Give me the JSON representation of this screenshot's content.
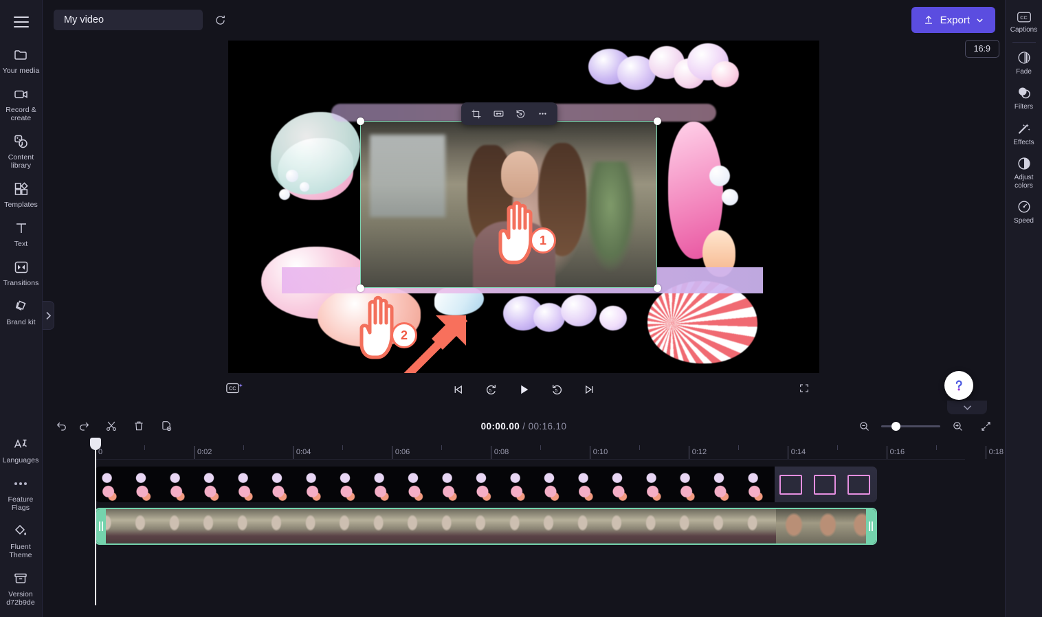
{
  "app": {
    "project_title": "My video",
    "export_label": "Export",
    "aspect_ratio": "16:9"
  },
  "left_rail": {
    "menu_icon": "hamburger-icon",
    "items": [
      {
        "label": "Your media",
        "icon": "folder-icon"
      },
      {
        "label": "Record & create",
        "icon": "video-camera-icon"
      },
      {
        "label": "Content library",
        "icon": "media-library-icon"
      },
      {
        "label": "Templates",
        "icon": "templates-grid-icon"
      },
      {
        "label": "Text",
        "icon": "text-T-icon"
      },
      {
        "label": "Transitions",
        "icon": "transitions-icon"
      },
      {
        "label": "Brand kit",
        "icon": "brand-kit-icon"
      }
    ],
    "bottom_items": [
      {
        "label": "Languages",
        "icon": "languages-icon"
      },
      {
        "label": "Feature Flags",
        "icon": "ellipsis-icon"
      },
      {
        "label": "Fluent Theme",
        "icon": "paint-drop-icon"
      },
      {
        "label": "Version d72b9de",
        "icon": "archive-box-icon"
      }
    ]
  },
  "right_rail": {
    "items": [
      {
        "label": "Captions",
        "icon": "cc-icon"
      },
      {
        "label": "Fade",
        "icon": "fade-circle-icon"
      },
      {
        "label": "Filters",
        "icon": "filters-overlap-icon"
      },
      {
        "label": "Effects",
        "icon": "magic-wand-icon"
      },
      {
        "label": "Adjust colors",
        "icon": "contrast-half-circle-icon"
      },
      {
        "label": "Speed",
        "icon": "speedometer-icon"
      }
    ]
  },
  "stage": {
    "chip_icon": "hardware-acceleration-chip-icon",
    "float_toolbar": [
      {
        "name": "crop",
        "icon": "crop-icon"
      },
      {
        "name": "fit",
        "icon": "fit-horizontal-arrows-icon"
      },
      {
        "name": "rotate",
        "icon": "rotate-icon"
      },
      {
        "name": "more",
        "icon": "more-ellipsis-icon"
      }
    ],
    "annotations": [
      {
        "number": "1",
        "type": "hand-cursor-marker"
      },
      {
        "number": "2",
        "type": "hand-cursor-marker"
      },
      {
        "type": "resize-diagonal-arrow"
      }
    ]
  },
  "playback": {
    "cc_icon": "cc-auto-captions-icon",
    "controls": [
      {
        "name": "skip-to-start",
        "icon": "skip-previous-icon"
      },
      {
        "name": "rewind-5",
        "icon": "rewind-5s-icon"
      },
      {
        "name": "play",
        "icon": "play-icon"
      },
      {
        "name": "forward-5",
        "icon": "forward-5s-icon"
      },
      {
        "name": "skip-to-end",
        "icon": "skip-next-icon"
      }
    ],
    "fullscreen_icon": "fullscreen-icon"
  },
  "help": {
    "icon": "question-mark-icon"
  },
  "timeline": {
    "toolbar": [
      {
        "name": "undo",
        "icon": "undo-arrow-icon"
      },
      {
        "name": "redo",
        "icon": "redo-arrow-icon"
      },
      {
        "name": "split",
        "icon": "scissors-icon"
      },
      {
        "name": "delete",
        "icon": "trash-icon"
      },
      {
        "name": "duplicate",
        "icon": "duplicate-icon"
      }
    ],
    "current_time": "00:00.00",
    "separator": "/",
    "total_time": "00:16.10",
    "zoom_out_icon": "zoom-out-icon",
    "zoom_in_icon": "zoom-in-icon",
    "fit_icon": "fit-to-screen-icon",
    "zoom_value": 18,
    "ruler_labels": [
      "0",
      "0:02",
      "0:04",
      "0:06",
      "0:08",
      "0:10",
      "0:12",
      "0:14",
      "0:16",
      "0:18"
    ],
    "ruler_max_seconds": 19.2,
    "tracks": [
      {
        "name": "overlay-track",
        "clip_start_s": 0,
        "clip_end_s": 14.9,
        "selected": false
      },
      {
        "name": "video-track",
        "clip_start_s": 0,
        "clip_end_s": 14.9,
        "selected": true
      }
    ]
  }
}
